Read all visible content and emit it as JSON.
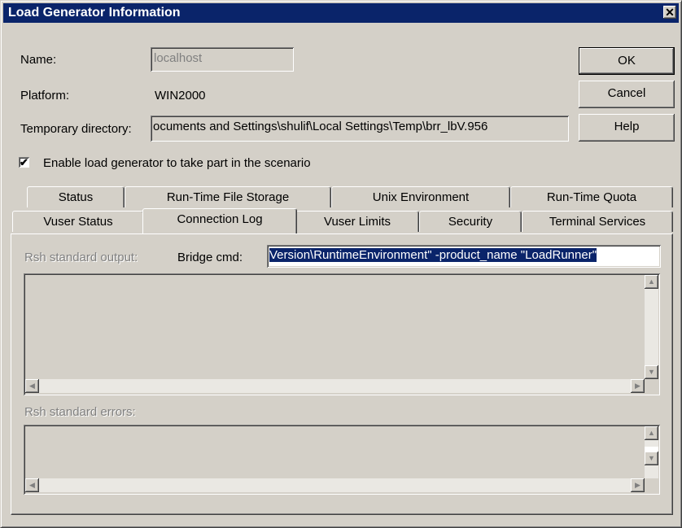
{
  "window": {
    "title": "Load Generator Information",
    "close_glyph": "✕"
  },
  "form": {
    "name_label": "Name:",
    "name_value": "localhost",
    "platform_label": "Platform:",
    "platform_value": "WIN2000",
    "tempdir_label": "Temporary directory:",
    "tempdir_value": "ocuments and Settings\\shulif\\Local Settings\\Temp\\brr_lbV.956",
    "enable_label": "Enable load generator to take part in the scenario",
    "enable_checked": true
  },
  "buttons": {
    "ok": "OK",
    "cancel": "Cancel",
    "help": "Help"
  },
  "tabs": {
    "back_row": [
      "Status",
      "Run-Time File Storage",
      "Unix Environment",
      "Run-Time Quota"
    ],
    "front_row": [
      "Vuser Status",
      "Connection Log",
      "Vuser Limits",
      "Security",
      "Terminal Services"
    ],
    "active": "Connection Log"
  },
  "connection_log": {
    "stdout_label": "Rsh standard output:",
    "bridge_label": "Bridge cmd:",
    "bridge_value": "Version\\RuntimeEnvironment\"  -product_name \"LoadRunner\"",
    "stderr_label": "Rsh standard errors:"
  },
  "icons": {
    "up": "▲",
    "down": "▼",
    "left": "◀",
    "right": "▶"
  }
}
